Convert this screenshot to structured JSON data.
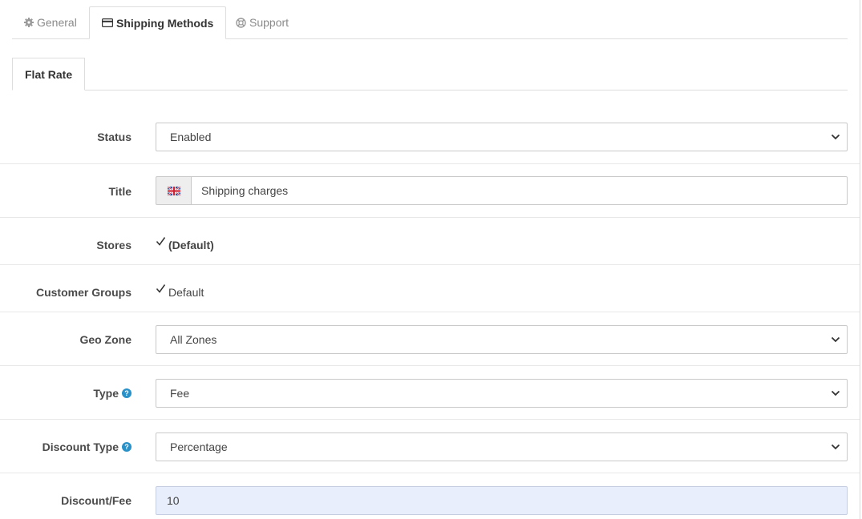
{
  "tabs": [
    {
      "label": "General",
      "icon": "gear-icon"
    },
    {
      "label": "Shipping Methods",
      "icon": "credit-card-icon"
    },
    {
      "label": "Support",
      "icon": "life-ring-icon"
    }
  ],
  "sub_tab": {
    "label": "Flat Rate"
  },
  "form": {
    "status": {
      "label": "Status",
      "value": "Enabled"
    },
    "title": {
      "label": "Title",
      "value": "Shipping charges",
      "flag": "uk-flag-icon"
    },
    "stores": {
      "label": "Stores",
      "option": "(Default)",
      "checked": true
    },
    "customer_groups": {
      "label": "Customer Groups",
      "option": "Default",
      "checked": true
    },
    "geo_zone": {
      "label": "Geo Zone",
      "value": "All Zones"
    },
    "type": {
      "label": "Type",
      "help": "?",
      "value": "Fee"
    },
    "discount_type": {
      "label": "Discount Type",
      "help": "?",
      "value": "Percentage"
    },
    "discount_fee": {
      "label": "Discount/Fee",
      "value": "10"
    }
  },
  "colors": {
    "help": "#2a91c8",
    "filled_input": "#e8eefb",
    "border": "#dddddd"
  }
}
